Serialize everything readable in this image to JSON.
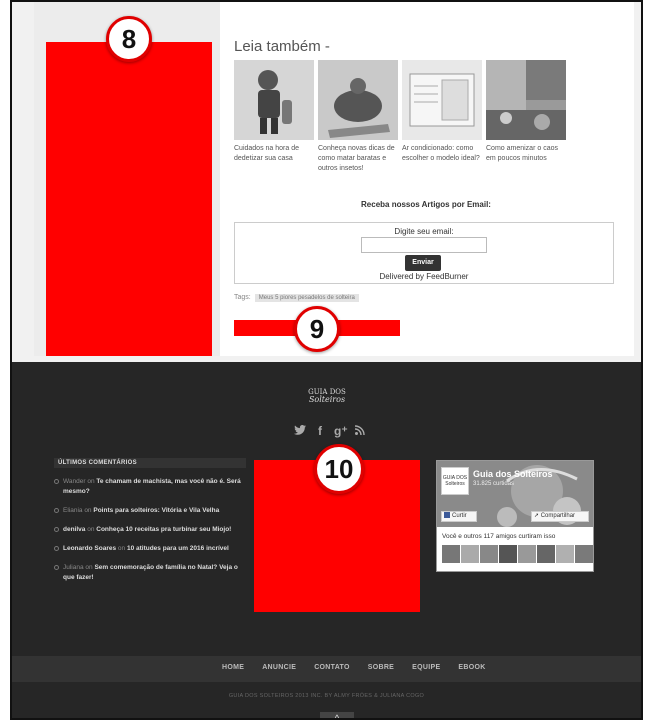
{
  "related": {
    "title": "Leia também -",
    "items": [
      {
        "caption": "Cuidados na hora de dedetizar sua casa"
      },
      {
        "caption": "Conheça novas dicas de como matar baratas e outros insetos!"
      },
      {
        "caption": "Ar condicionado: como escolher o modelo ideal?"
      },
      {
        "caption": "Como amenizar o caos em poucos minutos"
      }
    ]
  },
  "subscribe": {
    "title": "Receba nossos Artigos por Email:",
    "label": "Digite seu email:",
    "button": "Enviar",
    "delivered_prefix": "Delivered by ",
    "delivered_brand": "FeedBurner"
  },
  "tags": {
    "label": "Tags:",
    "chip": "Meus 5 piores pesadelos de solteira"
  },
  "markers": {
    "m8": "8",
    "m9": "9",
    "m10": "10"
  },
  "colors": {
    "ad_red": "#ff0000",
    "footer_bg": "#262626"
  },
  "footer": {
    "logo_line1": "GUIA DOS",
    "logo_line2": "Solteiros",
    "social_icons": [
      "twitter-icon",
      "facebook-icon",
      "google-plus-icon",
      "rss-icon"
    ],
    "comments_title": "ÚLTIMOS COMENTÁRIOS",
    "comments": [
      {
        "author": "Wander",
        "sep": " on ",
        "post": "Te chamam de machista, mas você não é. Será mesmo?"
      },
      {
        "author": "Eliania",
        "sep": " on ",
        "post": "Points para solteiros: Vitória e Vila Velha"
      },
      {
        "author": "denilva",
        "sep": " on ",
        "post": "Conheça 10 receitas pra turbinar seu Miojo!"
      },
      {
        "author": "Leonardo Soares",
        "sep": " on ",
        "post": "10 atitudes para um 2016 incrível"
      },
      {
        "author": "Juliana",
        "sep": " on ",
        "post": "Sem comemoração de família no Natal? Veja o que fazer!"
      }
    ],
    "facebook": {
      "page_name": "Guia dos Solteiros",
      "likes": "31.825 curtidas",
      "avatar_text": "GUIA DOS Solteiros",
      "like_button": "Curtir",
      "share_button": "Compartilhar",
      "friends_text": "Você e outros 117 amigos curtiram isso"
    },
    "nav": [
      "HOME",
      "ANUNCIE",
      "CONTATO",
      "SOBRE",
      "EQUIPE",
      "EBOOK"
    ],
    "credits": "GUIA DOS SOLTEIROS 2013 INC. BY ALMY FRÓES & JULIANA COGO",
    "back_to_top": "^"
  }
}
